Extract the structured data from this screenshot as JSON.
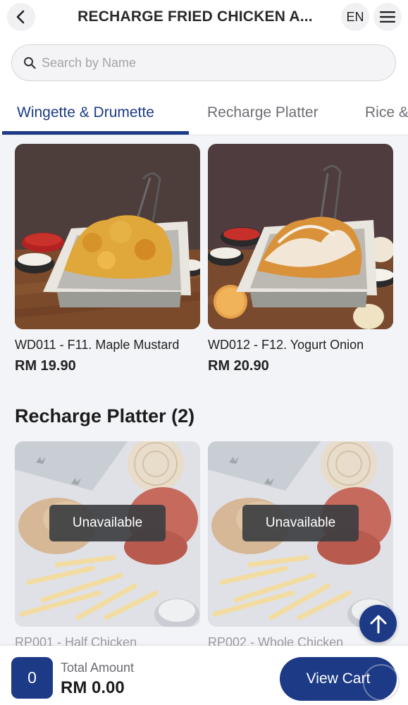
{
  "header": {
    "title": "RECHARGE FRIED CHICKEN A...",
    "language": "EN"
  },
  "search": {
    "placeholder": "Search by Name",
    "value": ""
  },
  "tabs": [
    {
      "label": "Wingette & Drumette",
      "active": true
    },
    {
      "label": "Recharge Platter",
      "active": false
    },
    {
      "label": "Rice &",
      "active": false
    }
  ],
  "products": [
    {
      "name": "WD011 - F11. Maple Mustard",
      "price": "RM 19.90"
    },
    {
      "name": "WD012 - F12. Yogurt Onion",
      "price": "RM 20.90"
    }
  ],
  "section": {
    "title": "Recharge Platter (2)"
  },
  "platters": [
    {
      "name": "RP001 - Half Chicken",
      "status": "Unavailable"
    },
    {
      "name": "RP002 - Whole Chicken",
      "status": "Unavailable"
    }
  ],
  "footer": {
    "count": "0",
    "total_label": "Total Amount",
    "total_value": "RM 0.00",
    "view_cart_label": "View Cart"
  },
  "colors": {
    "primary": "#1c3a86",
    "background": "#f3f4f7",
    "overlay": "#3c3e42"
  },
  "icons": [
    "back-arrow-icon",
    "hamburger-menu-icon",
    "search-icon",
    "arrow-up-icon"
  ]
}
